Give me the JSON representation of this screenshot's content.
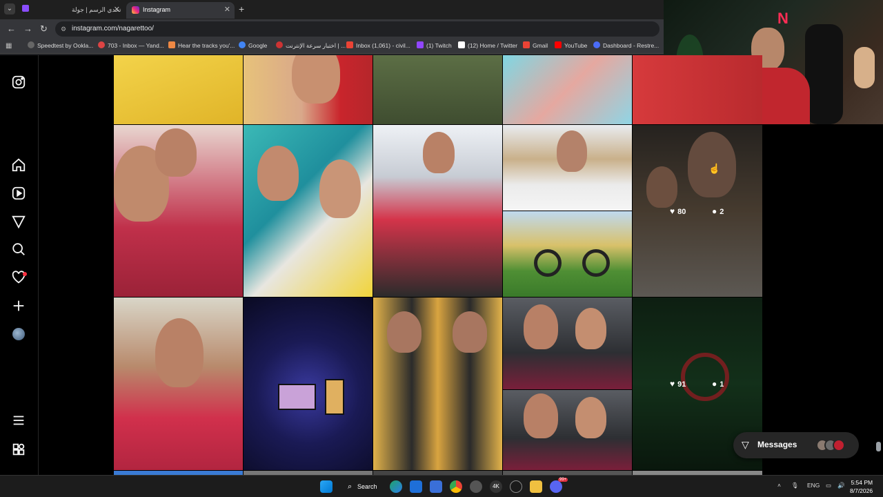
{
  "browser": {
    "tabs": [
      {
        "title": "تحدي الرسم | جولة",
        "active": false
      },
      {
        "title": "Instagram",
        "active": true
      }
    ],
    "url": "instagram.com/nagarettoo/",
    "bookmarks": [
      "Speedtest by Ookla...",
      "703 - Inbox — Yand...",
      "Hear the tracks you'...",
      "Google",
      "اختبار سرعة الإنترنت | ...",
      "Inbox (1,061) - civil...",
      "(1) Twitch",
      "(12) Home / Twitter",
      "Gmail",
      "YouTube",
      "Dashboard - Restre..."
    ]
  },
  "sidebar": {
    "icons": [
      "instagram-icon",
      "home-icon",
      "reels-icon",
      "explore-icon",
      "search-icon",
      "notifications-icon",
      "create-icon",
      "profile-avatar",
      "more-menu-icon",
      "also-from-meta-icon"
    ]
  },
  "grid": {
    "hover_post": {
      "likes": "80",
      "comments": "2"
    },
    "second_post": {
      "likes": "91",
      "comments": "1"
    }
  },
  "messages": {
    "label": "Messages"
  },
  "taskbar": {
    "search_label": "Search",
    "lang": "ENG",
    "time": "5:54 PM",
    "date": "8/7/2026",
    "badge": "99+"
  }
}
